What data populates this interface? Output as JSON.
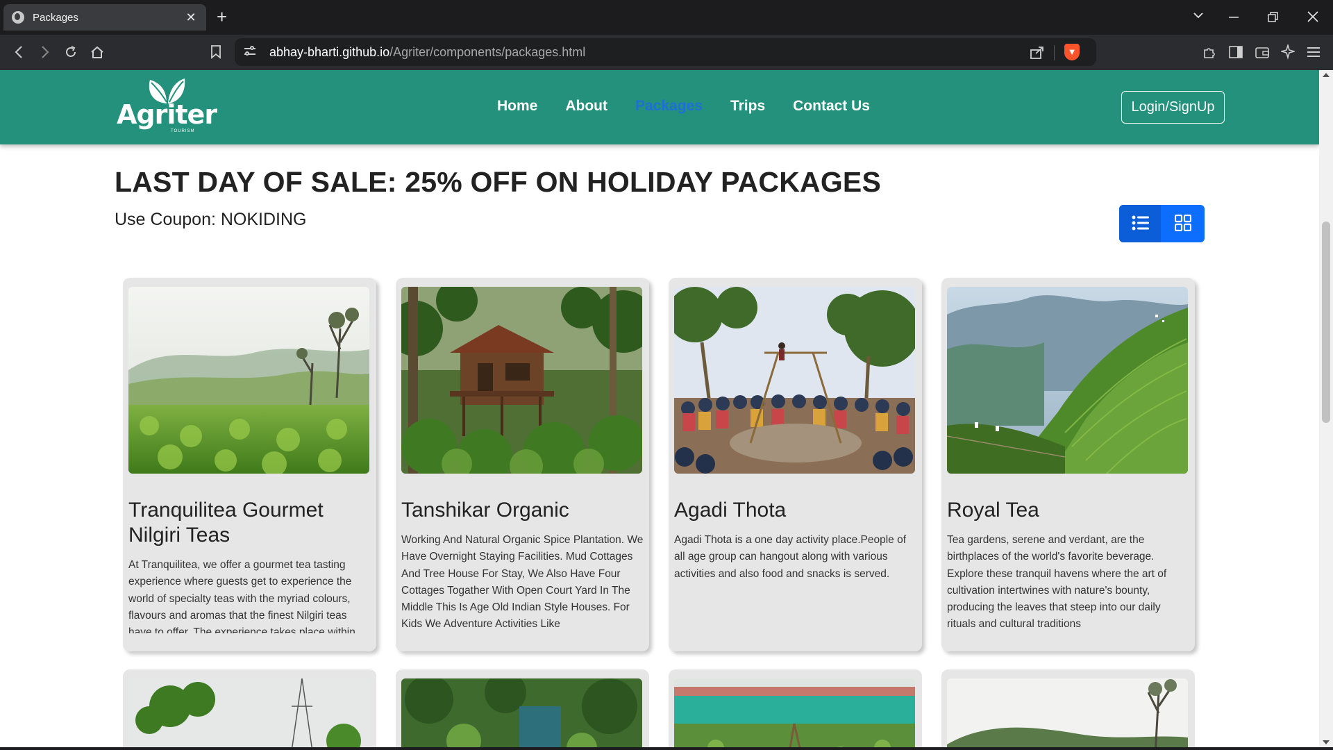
{
  "browser": {
    "tab_title": "Packages",
    "tab_close": "✕",
    "new_tab": "+",
    "url_host": "abhay-bharti.github.io",
    "url_path": "/Agriter/components/packages.html",
    "icons": [
      "back-icon",
      "forward-icon",
      "reload-icon",
      "home-icon",
      "bookmark-icon",
      "site-settings-icon",
      "share-icon",
      "brave-shield-icon",
      "extensions-icon",
      "sidebar-icon",
      "wallet-icon",
      "leo-ai-icon",
      "menu-icon"
    ]
  },
  "header": {
    "logo_text": "Agriter",
    "logo_sub": "TOURISM",
    "nav": [
      "Home",
      "About",
      "Packages",
      "Trips",
      "Contact Us"
    ],
    "active_nav": "Packages",
    "login_label": "Login/SignUp",
    "colors": {
      "header_bg": "#23917b",
      "active_link": "#1f6fd6",
      "toggle_bg": "#0d6efd"
    }
  },
  "sale": {
    "title": "LAST DAY OF SALE: 25% OFF ON HOLIDAY PACKAGES",
    "coupon": "Use Coupon: NOKIDING"
  },
  "packages": [
    {
      "title": "Tranquilitea Gourmet Nilgiri Teas",
      "description": "At Tranquilitea, we offer a gourmet tea tasting experience where guests get to experience the world of specialty teas with the myriad colours, flavours and aromas that the finest Nilgiri teas have to offer. The experience takes place within"
    },
    {
      "title": "Tanshikar Organic",
      "description": "Working And Natural Organic Spice Plantation. We Have Overnight Staying Facilities. Mud Cottages And Tree House For Stay, We Also Have Four Cottages Togather With Open Court Yard In The Middle This Is Age Old Indian Style Houses. For Kids We Adventure Activities Like"
    },
    {
      "title": "Agadi Thota",
      "description": "Agadi Thota is a one day activity place.People of all age group can hangout along with various activities and also food and snacks is served."
    },
    {
      "title": "Royal Tea",
      "description": "Tea gardens, serene and verdant, are the birthplaces of the world's favorite beverage. Explore these tranquil havens where the art of cultivation intertwines with nature's bounty, producing the leaves that steep into our daily rituals and cultural traditions"
    }
  ]
}
